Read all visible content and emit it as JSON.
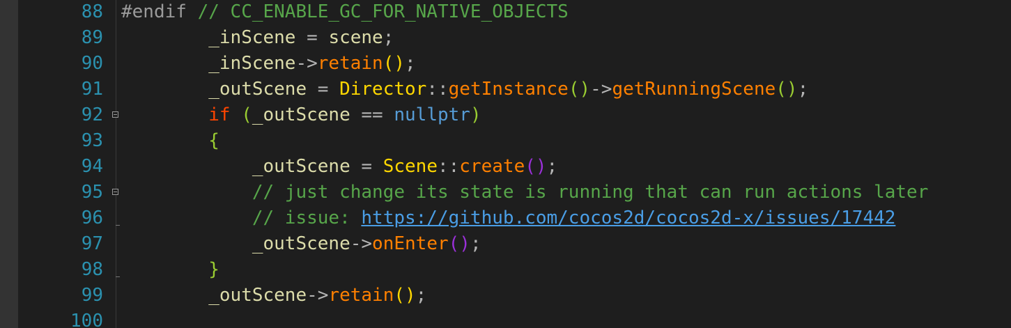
{
  "lines": [
    {
      "number": "88",
      "tokens": [
        {
          "t": "#endif",
          "c": "pre"
        },
        {
          "t": " // CC_ENABLE_GC_FOR_NATIVE_OBJECTS",
          "c": "cmt"
        }
      ]
    },
    {
      "number": "89",
      "tokens": [
        {
          "t": "        ",
          "c": "id"
        },
        {
          "t": "_inScene",
          "c": "var"
        },
        {
          "t": " = ",
          "c": "op"
        },
        {
          "t": "scene",
          "c": "var"
        },
        {
          "t": ";",
          "c": "op"
        }
      ]
    },
    {
      "number": "90",
      "tokens": [
        {
          "t": "        ",
          "c": "id"
        },
        {
          "t": "_inScene",
          "c": "var"
        },
        {
          "t": "->",
          "c": "op"
        },
        {
          "t": "retain",
          "c": "fn"
        },
        {
          "t": "()",
          "c": "par1"
        },
        {
          "t": ";",
          "c": "op"
        }
      ]
    },
    {
      "number": "91",
      "tokens": [
        {
          "t": "        ",
          "c": "id"
        },
        {
          "t": "_outScene",
          "c": "var"
        },
        {
          "t": " = ",
          "c": "op"
        },
        {
          "t": "Director",
          "c": "cls"
        },
        {
          "t": "::",
          "c": "op"
        },
        {
          "t": "getInstance",
          "c": "fn"
        },
        {
          "t": "()",
          "c": "par2"
        },
        {
          "t": "->",
          "c": "op"
        },
        {
          "t": "getRunningScene",
          "c": "fn"
        },
        {
          "t": "()",
          "c": "par2"
        },
        {
          "t": ";",
          "c": "op"
        }
      ]
    },
    {
      "number": "92",
      "fold": "open",
      "tokens": [
        {
          "t": "        ",
          "c": "id"
        },
        {
          "t": "if",
          "c": "ctl"
        },
        {
          "t": " ",
          "c": "id"
        },
        {
          "t": "(",
          "c": "par2"
        },
        {
          "t": "_outScene",
          "c": "var"
        },
        {
          "t": " == ",
          "c": "op"
        },
        {
          "t": "nullptr",
          "c": "lit"
        },
        {
          "t": ")",
          "c": "par2"
        }
      ]
    },
    {
      "number": "93",
      "tokens": [
        {
          "t": "        ",
          "c": "id"
        },
        {
          "t": "{",
          "c": "par2"
        }
      ]
    },
    {
      "number": "94",
      "tokens": [
        {
          "t": "            ",
          "c": "id"
        },
        {
          "t": "_outScene",
          "c": "var"
        },
        {
          "t": " = ",
          "c": "op"
        },
        {
          "t": "Scene",
          "c": "cls"
        },
        {
          "t": "::",
          "c": "op"
        },
        {
          "t": "create",
          "c": "fn"
        },
        {
          "t": "()",
          "c": "par3"
        },
        {
          "t": ";",
          "c": "op"
        }
      ]
    },
    {
      "number": "95",
      "fold": "open",
      "tokens": [
        {
          "t": "            ",
          "c": "id"
        },
        {
          "t": "// just change its state is running that can run actions later",
          "c": "cmt"
        }
      ]
    },
    {
      "number": "96",
      "fold": "end",
      "tokens": [
        {
          "t": "            ",
          "c": "id"
        },
        {
          "t": "// issue: ",
          "c": "cmt"
        },
        {
          "t": "https://github.com/cocos2d/cocos2d-x/issues/17442",
          "c": "link"
        }
      ]
    },
    {
      "number": "97",
      "tokens": [
        {
          "t": "            ",
          "c": "id"
        },
        {
          "t": "_outScene",
          "c": "var"
        },
        {
          "t": "->",
          "c": "op"
        },
        {
          "t": "onEnter",
          "c": "fn"
        },
        {
          "t": "()",
          "c": "par3"
        },
        {
          "t": ";",
          "c": "op"
        }
      ]
    },
    {
      "number": "98",
      "fold": "end",
      "tokens": [
        {
          "t": "        ",
          "c": "id"
        },
        {
          "t": "}",
          "c": "par2"
        }
      ]
    },
    {
      "number": "99",
      "tokens": [
        {
          "t": "        ",
          "c": "id"
        },
        {
          "t": "_outScene",
          "c": "var"
        },
        {
          "t": "->",
          "c": "op"
        },
        {
          "t": "retain",
          "c": "fn"
        },
        {
          "t": "()",
          "c": "par1"
        },
        {
          "t": ";",
          "c": "op"
        }
      ]
    },
    {
      "number": "100",
      "tokens": []
    }
  ]
}
